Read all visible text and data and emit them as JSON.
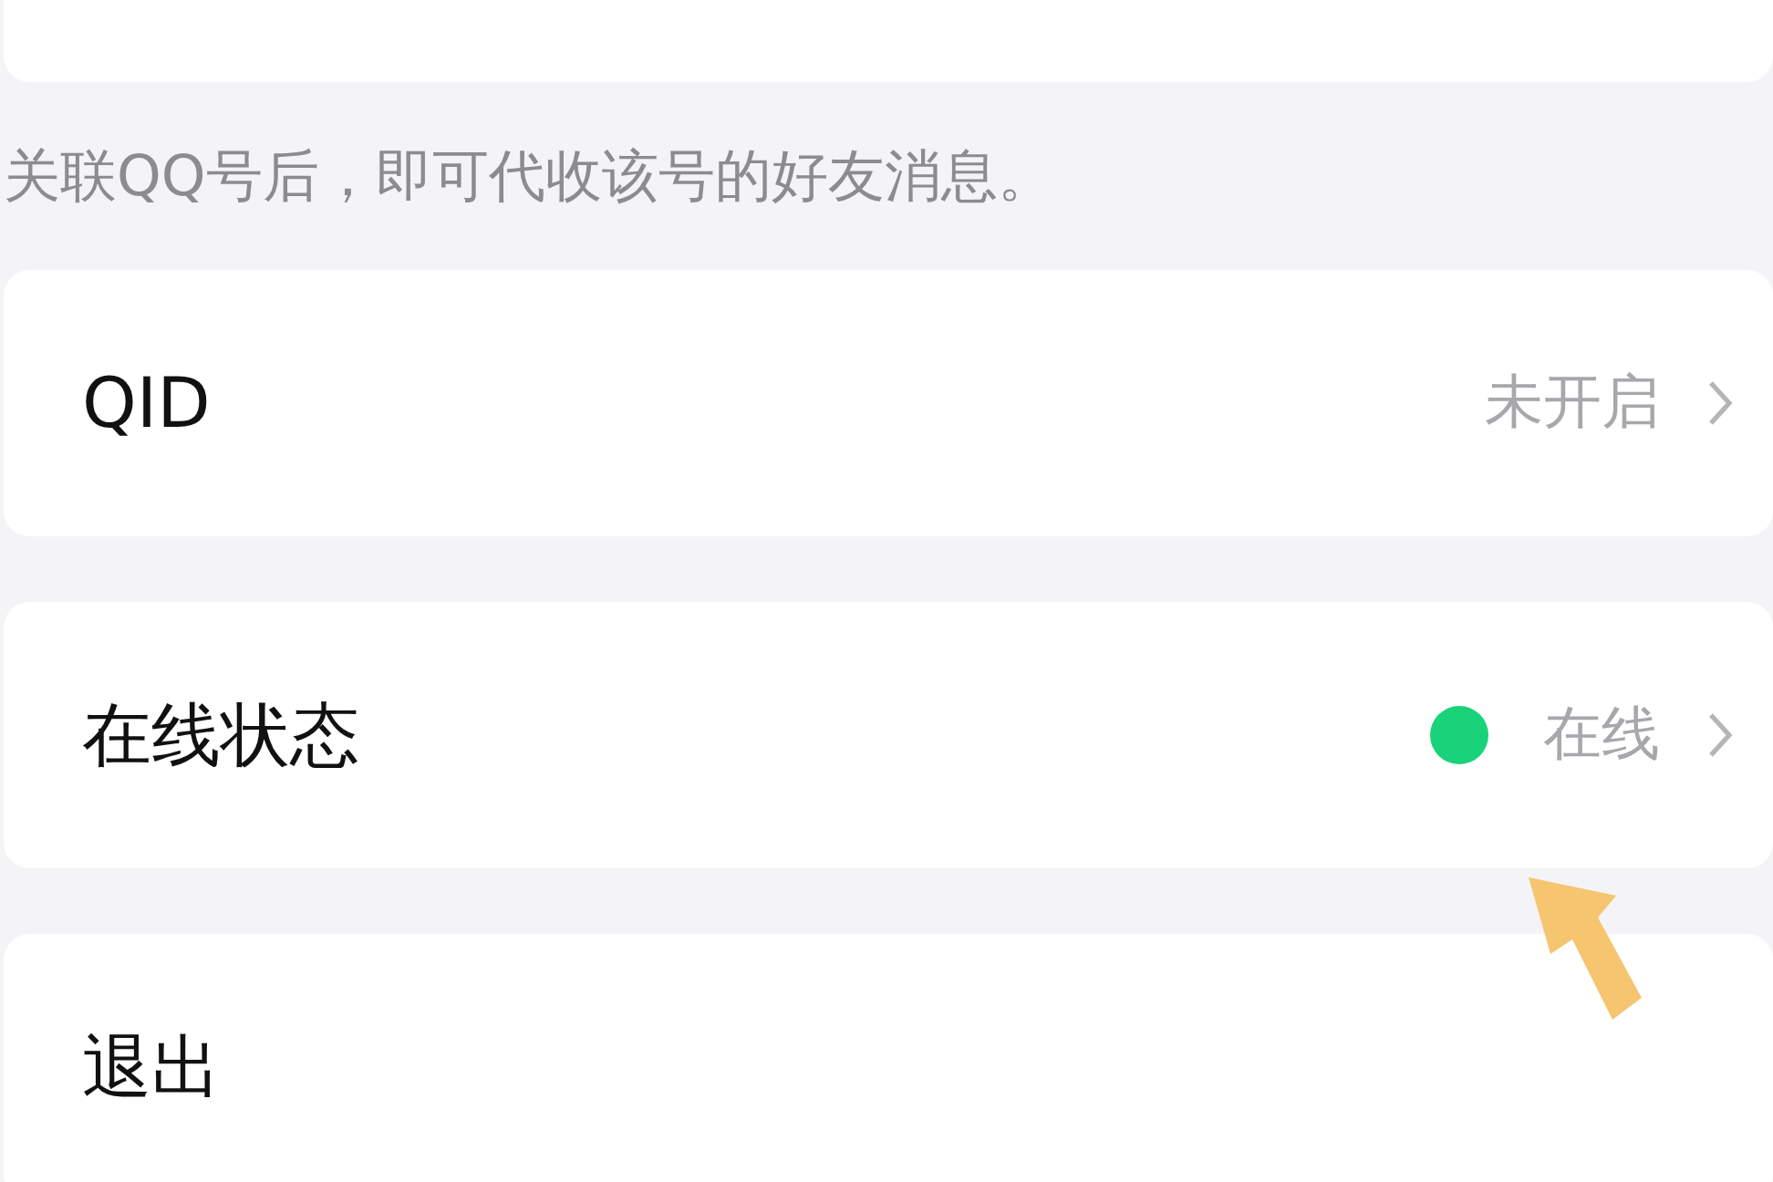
{
  "hint": "关联QQ号后，即可代收该号的好友消息。",
  "items": [
    {
      "kind": "value",
      "label": "QID",
      "value": "未开启",
      "chevron": true
    },
    {
      "kind": "status",
      "label": "在线状态",
      "value": "在线",
      "color": "#1ad27a",
      "chevron": true
    },
    {
      "kind": "plain",
      "label": "退出",
      "chevron": false
    }
  ]
}
